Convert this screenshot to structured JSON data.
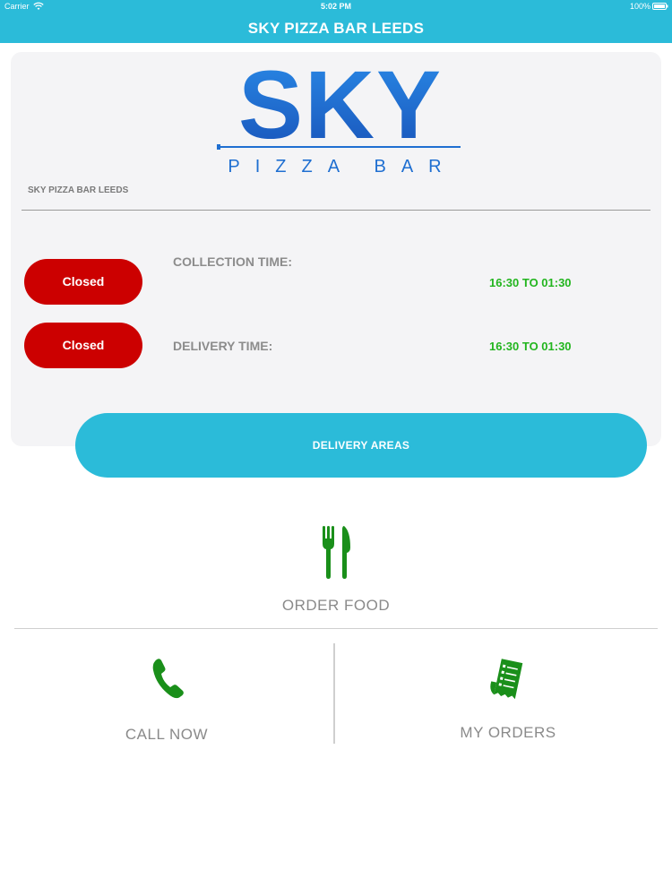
{
  "status_bar": {
    "carrier": "Carrier",
    "time": "5:02 PM",
    "battery": "100%"
  },
  "header": {
    "title": "SKY PIZZA BAR LEEDS"
  },
  "logo": {
    "main": "SKY",
    "sub": "PIZZA BAR",
    "color": "#1f6fd1"
  },
  "card": {
    "subtitle": "SKY PIZZA BAR LEEDS",
    "collection": {
      "status": "Closed",
      "label": "COLLECTION TIME:",
      "hours": "16:30 TO 01:30"
    },
    "delivery": {
      "status": "Closed",
      "label": "DELIVERY TIME:",
      "hours": "16:30 TO 01:30"
    }
  },
  "actions": {
    "delivery_areas": "DELIVERY AREAS",
    "order_food": "ORDER FOOD",
    "call_now": "CALL NOW",
    "my_orders": "MY ORDERS"
  },
  "colors": {
    "accent": "#2bbbd9",
    "closed": "#cc0000",
    "hours": "#22b51e",
    "icon_green": "#1a8f1a"
  },
  "icons": [
    "wifi-icon",
    "battery-icon",
    "fork-knife-icon",
    "phone-icon",
    "receipt-icon"
  ]
}
